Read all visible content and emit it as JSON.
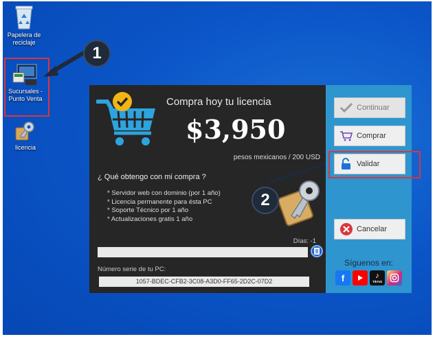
{
  "desktop": {
    "icons": [
      {
        "label_1": "Papelera de",
        "label_2": "reciclaje",
        "icon": "recycle-bin-icon"
      },
      {
        "label_1": "Sucursales -",
        "label_2": "Punto Venta",
        "icon": "pos-app-icon"
      },
      {
        "label_1": "licencia",
        "label_2": "",
        "icon": "key-icon"
      }
    ],
    "markers": [
      "1",
      "2"
    ]
  },
  "license": {
    "title": "Compra hoy tu licencia",
    "price": "$3,950",
    "currency_note": "pesos mexicanos / 200 USD",
    "question": "¿ Qué obtengo con mi compra ?",
    "benefits": [
      "* Servidor web con dominio (por 1 año)",
      "* Licencia permanente para ésta PC",
      "* Soporte Técnico por 1 año",
      "* Actualizaciones gratis 1 año"
    ],
    "days_label": "Días: -1",
    "days_value": "",
    "serial_label": "Número serie de tu PC:",
    "serial": "1057-BDEC-CFB2-3C08-A3D0-FF65-2D2C-07D2"
  },
  "sidebar": {
    "continue": "Continuar",
    "buy": "Comprar",
    "validate": "Validar",
    "cancel": "Cancelar",
    "follow": "Síguenos en:",
    "socials": [
      "facebook-icon",
      "youtube-icon",
      "tiktok-icon",
      "instagram-icon"
    ],
    "tiktok_caption": "TikTok"
  },
  "colors": {
    "panel": "#262626",
    "sidebar": "#2e95cf",
    "highlight": "#d9363e",
    "cart": "#2ea3de",
    "check": "#f2b515"
  }
}
